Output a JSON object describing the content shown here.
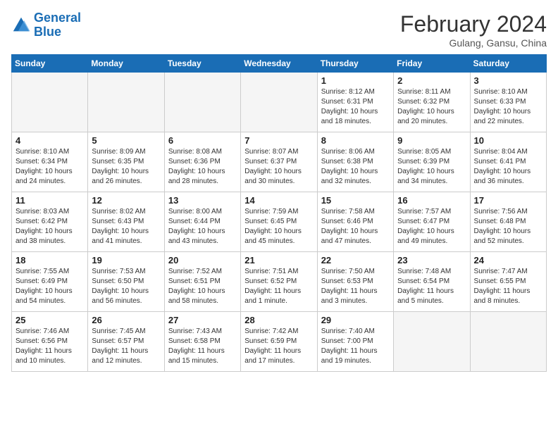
{
  "logo": {
    "line1": "General",
    "line2": "Blue"
  },
  "title": "February 2024",
  "subtitle": "Gulang, Gansu, China",
  "days_of_week": [
    "Sunday",
    "Monday",
    "Tuesday",
    "Wednesday",
    "Thursday",
    "Friday",
    "Saturday"
  ],
  "weeks": [
    [
      {
        "num": "",
        "info": ""
      },
      {
        "num": "",
        "info": ""
      },
      {
        "num": "",
        "info": ""
      },
      {
        "num": "",
        "info": ""
      },
      {
        "num": "1",
        "info": "Sunrise: 8:12 AM\nSunset: 6:31 PM\nDaylight: 10 hours\nand 18 minutes."
      },
      {
        "num": "2",
        "info": "Sunrise: 8:11 AM\nSunset: 6:32 PM\nDaylight: 10 hours\nand 20 minutes."
      },
      {
        "num": "3",
        "info": "Sunrise: 8:10 AM\nSunset: 6:33 PM\nDaylight: 10 hours\nand 22 minutes."
      }
    ],
    [
      {
        "num": "4",
        "info": "Sunrise: 8:10 AM\nSunset: 6:34 PM\nDaylight: 10 hours\nand 24 minutes."
      },
      {
        "num": "5",
        "info": "Sunrise: 8:09 AM\nSunset: 6:35 PM\nDaylight: 10 hours\nand 26 minutes."
      },
      {
        "num": "6",
        "info": "Sunrise: 8:08 AM\nSunset: 6:36 PM\nDaylight: 10 hours\nand 28 minutes."
      },
      {
        "num": "7",
        "info": "Sunrise: 8:07 AM\nSunset: 6:37 PM\nDaylight: 10 hours\nand 30 minutes."
      },
      {
        "num": "8",
        "info": "Sunrise: 8:06 AM\nSunset: 6:38 PM\nDaylight: 10 hours\nand 32 minutes."
      },
      {
        "num": "9",
        "info": "Sunrise: 8:05 AM\nSunset: 6:39 PM\nDaylight: 10 hours\nand 34 minutes."
      },
      {
        "num": "10",
        "info": "Sunrise: 8:04 AM\nSunset: 6:41 PM\nDaylight: 10 hours\nand 36 minutes."
      }
    ],
    [
      {
        "num": "11",
        "info": "Sunrise: 8:03 AM\nSunset: 6:42 PM\nDaylight: 10 hours\nand 38 minutes."
      },
      {
        "num": "12",
        "info": "Sunrise: 8:02 AM\nSunset: 6:43 PM\nDaylight: 10 hours\nand 41 minutes."
      },
      {
        "num": "13",
        "info": "Sunrise: 8:00 AM\nSunset: 6:44 PM\nDaylight: 10 hours\nand 43 minutes."
      },
      {
        "num": "14",
        "info": "Sunrise: 7:59 AM\nSunset: 6:45 PM\nDaylight: 10 hours\nand 45 minutes."
      },
      {
        "num": "15",
        "info": "Sunrise: 7:58 AM\nSunset: 6:46 PM\nDaylight: 10 hours\nand 47 minutes."
      },
      {
        "num": "16",
        "info": "Sunrise: 7:57 AM\nSunset: 6:47 PM\nDaylight: 10 hours\nand 49 minutes."
      },
      {
        "num": "17",
        "info": "Sunrise: 7:56 AM\nSunset: 6:48 PM\nDaylight: 10 hours\nand 52 minutes."
      }
    ],
    [
      {
        "num": "18",
        "info": "Sunrise: 7:55 AM\nSunset: 6:49 PM\nDaylight: 10 hours\nand 54 minutes."
      },
      {
        "num": "19",
        "info": "Sunrise: 7:53 AM\nSunset: 6:50 PM\nDaylight: 10 hours\nand 56 minutes."
      },
      {
        "num": "20",
        "info": "Sunrise: 7:52 AM\nSunset: 6:51 PM\nDaylight: 10 hours\nand 58 minutes."
      },
      {
        "num": "21",
        "info": "Sunrise: 7:51 AM\nSunset: 6:52 PM\nDaylight: 11 hours\nand 1 minute."
      },
      {
        "num": "22",
        "info": "Sunrise: 7:50 AM\nSunset: 6:53 PM\nDaylight: 11 hours\nand 3 minutes."
      },
      {
        "num": "23",
        "info": "Sunrise: 7:48 AM\nSunset: 6:54 PM\nDaylight: 11 hours\nand 5 minutes."
      },
      {
        "num": "24",
        "info": "Sunrise: 7:47 AM\nSunset: 6:55 PM\nDaylight: 11 hours\nand 8 minutes."
      }
    ],
    [
      {
        "num": "25",
        "info": "Sunrise: 7:46 AM\nSunset: 6:56 PM\nDaylight: 11 hours\nand 10 minutes."
      },
      {
        "num": "26",
        "info": "Sunrise: 7:45 AM\nSunset: 6:57 PM\nDaylight: 11 hours\nand 12 minutes."
      },
      {
        "num": "27",
        "info": "Sunrise: 7:43 AM\nSunset: 6:58 PM\nDaylight: 11 hours\nand 15 minutes."
      },
      {
        "num": "28",
        "info": "Sunrise: 7:42 AM\nSunset: 6:59 PM\nDaylight: 11 hours\nand 17 minutes."
      },
      {
        "num": "29",
        "info": "Sunrise: 7:40 AM\nSunset: 7:00 PM\nDaylight: 11 hours\nand 19 minutes."
      },
      {
        "num": "",
        "info": ""
      },
      {
        "num": "",
        "info": ""
      }
    ]
  ]
}
